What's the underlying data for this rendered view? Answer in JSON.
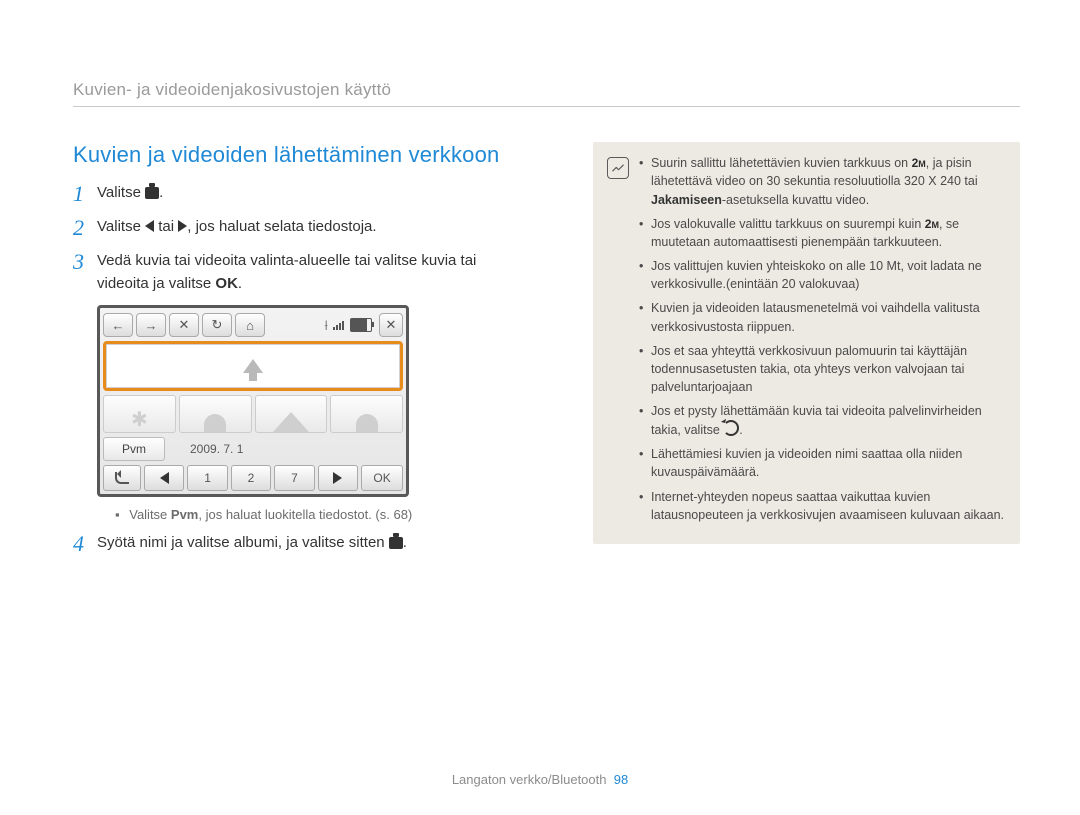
{
  "header": "Kuvien- ja videoidenjakosivustojen käyttö",
  "heading": "Kuvien ja videoiden lähettäminen verkkoon",
  "steps": {
    "s1": {
      "num": "1",
      "pre": "Valitse ",
      "post": "."
    },
    "s2": {
      "num": "2",
      "pre": "Valitse ",
      "mid": " tai ",
      "post": ", jos haluat selata tiedostoja."
    },
    "s3": {
      "num": "3",
      "line1": "Vedä kuvia tai videoita valinta-alueelle tai valitse kuvia tai",
      "line2a": "videoita ja valitse ",
      "line2b_strong": "OK",
      "line2c": "."
    },
    "s4": {
      "num": "4",
      "pre": "Syötä nimi ja valitse albumi, ja valitse sitten ",
      "post": "."
    }
  },
  "subbullet": {
    "pre": "Valitse ",
    "strong": "Pvm",
    "post": ", jos haluat luokitella tiedostot. (s. 68)"
  },
  "device": {
    "pvm_label": "Pvm",
    "date_label": "2009. 7. 1",
    "num1": "1",
    "num2": "2",
    "num7": "7",
    "ok": "OK"
  },
  "info": {
    "items": [
      {
        "pre": "Suurin sallittu lähetettävien kuvien tarkkuus on ",
        "size": "2m",
        "mid": ", ja pisin lähetettävä video on 30 sekuntia resoluutiolla 320 X 240 tai ",
        "strong": "Jakamiseen",
        "post": "-asetuksella kuvattu video."
      },
      {
        "pre": "Jos valokuvalle valittu tarkkuus on suurempi kuin ",
        "size": "2m",
        "post": ", se muutetaan automaattisesti pienempään tarkkuuteen."
      },
      {
        "text": "Jos valittujen kuvien yhteiskoko on alle 10 Mt, voit ladata ne verkkosivulle.(enintään 20 valokuvaa)"
      },
      {
        "text": "Kuvien ja videoiden latausmenetelmä voi vaihdella valitusta verkkosivustosta riippuen."
      },
      {
        "text": "Jos et saa yhteyttä verkkosivuun palomuurin tai käyttäjän todennusasetusten takia, ota yhteys verkon valvojaan tai palveluntarjoajaan"
      },
      {
        "pre": "Jos et pysty lähettämään kuvia tai videoita palvelinvirheiden takia, valitse ",
        "refresh": true,
        "post": "."
      },
      {
        "text": "Lähettämiesi kuvien ja videoiden nimi saattaa olla niiden kuvauspäivämäärä."
      },
      {
        "text": "Internet-yhteyden nopeus saattaa vaikuttaa kuvien latausnopeuteen ja verkkosivujen avaamiseen kuluvaan aikaan."
      }
    ]
  },
  "footer": {
    "label": "Langaton verkko/Bluetooth",
    "page": "98"
  }
}
